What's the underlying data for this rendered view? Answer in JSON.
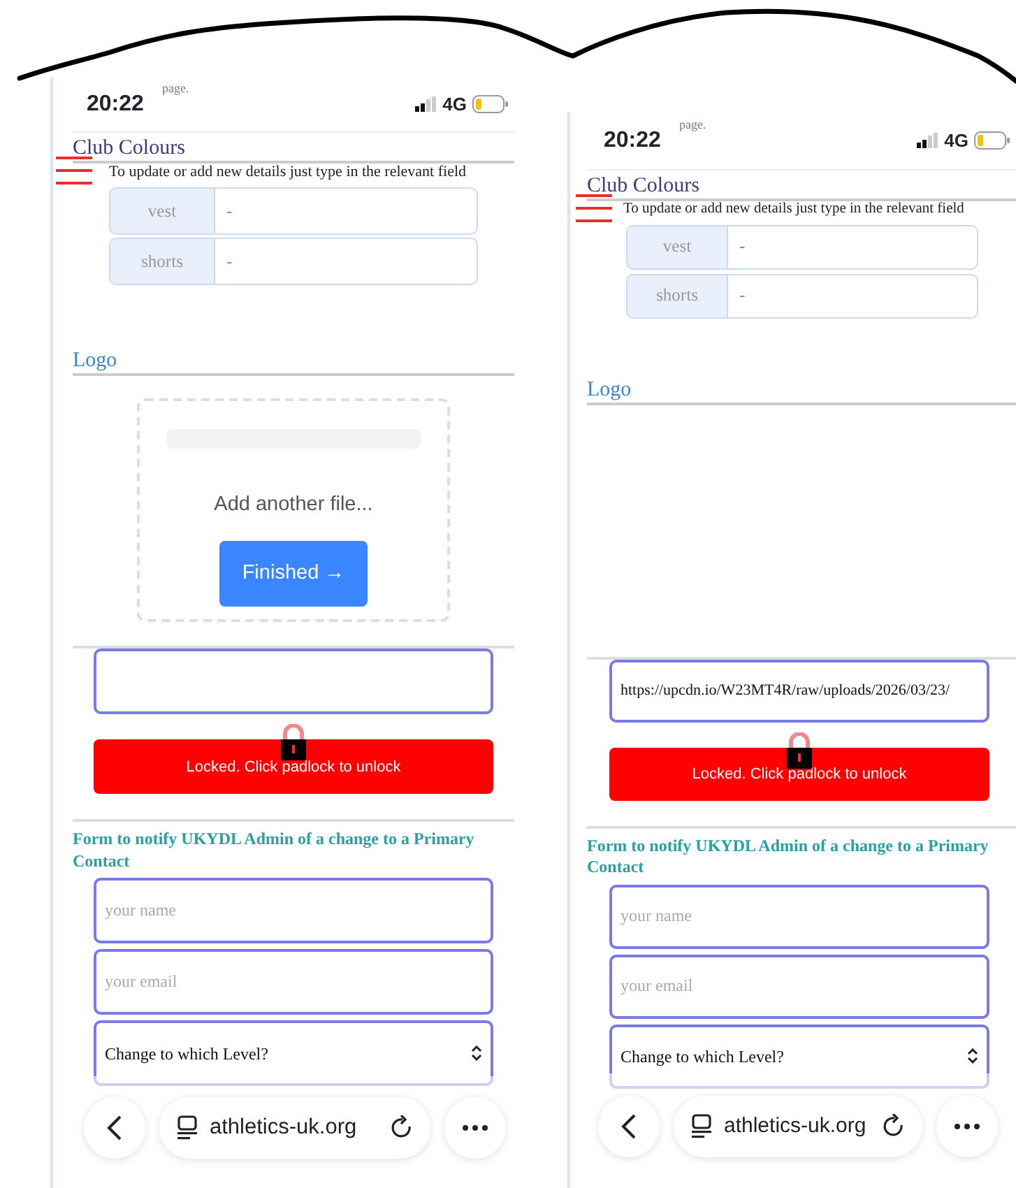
{
  "screens": [
    {
      "status": {
        "time": "20:22",
        "overlay_text": "page.",
        "network": "4G"
      },
      "club_colours": {
        "title": "Club Colours",
        "hint": "To update or add new details just type in the relevant field",
        "fields": [
          {
            "label": "vest",
            "value": "-"
          },
          {
            "label": "shorts",
            "value": "-"
          }
        ]
      },
      "logo": {
        "title": "Logo",
        "uploader": {
          "prompt": "Add another file...",
          "button": "Finished →"
        }
      },
      "lock": {
        "label": "Locked. Click padlock to unlock",
        "locked": true
      },
      "form": {
        "title": "Form to notify UKYDL Admin of a change to a Primary Contact",
        "fields": [
          {
            "kind": "input",
            "placeholder": "your name"
          },
          {
            "kind": "input",
            "placeholder": "your email"
          },
          {
            "kind": "select",
            "value": "Change to which Level?"
          }
        ]
      },
      "browser_bar": {
        "url": "athletics-uk.org"
      }
    },
    {
      "status": {
        "time": "20:22",
        "overlay_text": "page.",
        "network": "4G"
      },
      "club_colours": {
        "title": "Club Colours",
        "hint": "To update or add new details just type in the relevant field",
        "fields": [
          {
            "label": "vest",
            "value": "-"
          },
          {
            "label": "shorts",
            "value": "-"
          }
        ]
      },
      "logo": {
        "title": "Logo"
      },
      "url_field": {
        "value": "https://upcdn.io/W23MT4R/raw/uploads/2026/03/23/"
      },
      "lock": {
        "label": "Locked. Click padlock to unlock",
        "locked": true
      },
      "form": {
        "title": "Form to notify UKYDL Admin of a change to a Primary Contact",
        "fields": [
          {
            "kind": "input",
            "placeholder": "your name"
          },
          {
            "kind": "input",
            "placeholder": "your email"
          },
          {
            "kind": "select",
            "value": "Change to which Level?"
          }
        ]
      },
      "browser_bar": {
        "url": "athletics-uk.org"
      }
    }
  ]
}
